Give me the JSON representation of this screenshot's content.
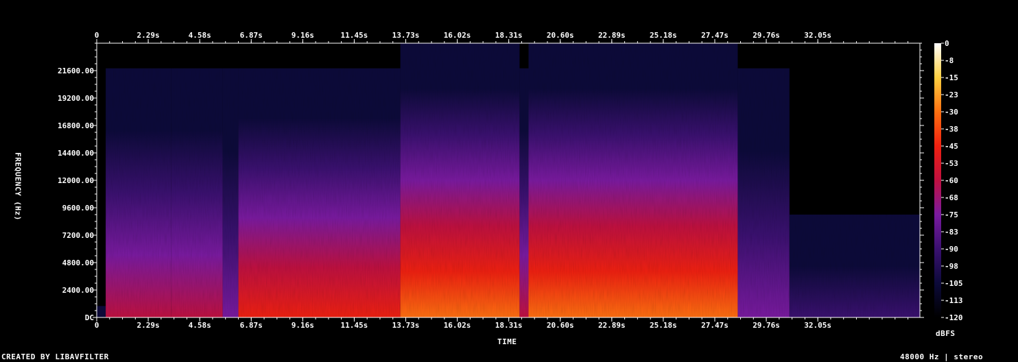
{
  "chart_data": {
    "type": "heatmap",
    "title": "",
    "xlabel": "TIME",
    "ylabel": "FREQUENCY (Hz)",
    "x_ticks": [
      "0",
      "2.29s",
      "4.58s",
      "6.87s",
      "9.16s",
      "11.45s",
      "13.73s",
      "16.02s",
      "18.31s",
      "20.60s",
      "22.89s",
      "25.18s",
      "27.47s",
      "29.76s",
      "32.05s"
    ],
    "y_ticks": [
      "DC",
      "2400.00",
      "4800.00",
      "7200.00",
      "9600.00",
      "12000.00",
      "14400.00",
      "16800.00",
      "19200.00",
      "21600.00"
    ],
    "y_values": [
      0,
      2400,
      4800,
      7200,
      9600,
      12000,
      14400,
      16800,
      19200,
      21600
    ],
    "xlim": [
      0,
      36.6
    ],
    "ylim": [
      0,
      24000
    ],
    "colorbar": {
      "label": "dBFS",
      "ticks": [
        "0",
        "-8",
        "-15",
        "-23",
        "-30",
        "-38",
        "-45",
        "-53",
        "-60",
        "-68",
        "-75",
        "-83",
        "-90",
        "-98",
        "-105",
        "-113",
        "-120"
      ],
      "range": [
        -120,
        0
      ],
      "colors": [
        "#000000",
        "#0c0a3a",
        "#3a1070",
        "#7a1aa0",
        "#c01040",
        "#f02010",
        "#ff7010",
        "#ffd040",
        "#ffffff"
      ]
    },
    "segments": [
      {
        "start": 0.0,
        "end": 0.4,
        "level": 0.05,
        "cutoff": 1000
      },
      {
        "start": 0.4,
        "end": 3.3,
        "level": 0.45,
        "cutoff": 21800
      },
      {
        "start": 3.3,
        "end": 5.6,
        "level": 0.55,
        "cutoff": 21800
      },
      {
        "start": 5.6,
        "end": 6.3,
        "level": 0.35,
        "cutoff": 21800
      },
      {
        "start": 6.3,
        "end": 13.5,
        "level": 0.68,
        "cutoff": 21800
      },
      {
        "start": 13.5,
        "end": 18.8,
        "level": 0.78,
        "cutoff": 24000
      },
      {
        "start": 18.8,
        "end": 19.2,
        "level": 0.55,
        "cutoff": 21800
      },
      {
        "start": 19.2,
        "end": 28.5,
        "level": 0.76,
        "cutoff": 24000
      },
      {
        "start": 28.5,
        "end": 30.8,
        "level": 0.42,
        "cutoff": 21800
      },
      {
        "start": 30.8,
        "end": 36.6,
        "level": 0.25,
        "cutoff": 9000
      }
    ]
  },
  "footer": {
    "credit": "CREATED BY LIBAVFILTER",
    "info": "48000 Hz | stereo"
  }
}
